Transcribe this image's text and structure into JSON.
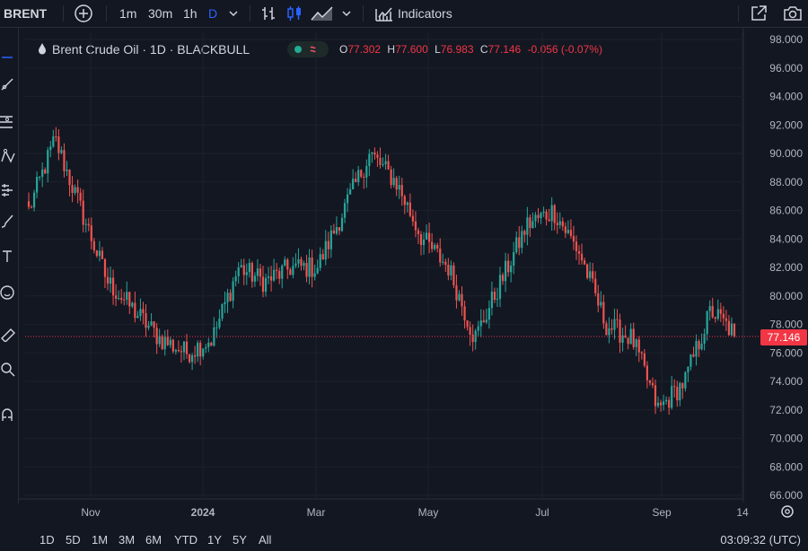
{
  "toolbar": {
    "symbol": "BRENT",
    "intervals": [
      "1m",
      "30m",
      "1h",
      "D"
    ],
    "active_interval": "D",
    "indicators_label": "Indicators"
  },
  "legend": {
    "title": "Brent Crude Oil · 1D · BLACKBULL",
    "open_label": "O",
    "open": "77.302",
    "high_label": "H",
    "high": "77.600",
    "low_label": "L",
    "low": "76.983",
    "close_label": "C",
    "close": "77.146",
    "change": "-0.056 (-0.07%)"
  },
  "price_scale": {
    "ticks": [
      "98.000",
      "96.000",
      "94.000",
      "92.000",
      "90.000",
      "88.000",
      "86.000",
      "84.000",
      "82.000",
      "80.000",
      "78.000",
      "76.000",
      "74.000",
      "72.000",
      "70.000",
      "68.000",
      "66.000"
    ],
    "last_price": "77.146"
  },
  "time_scale": {
    "labels": [
      "Nov",
      "2024",
      "Mar",
      "May",
      "Jul",
      "Sep",
      "14"
    ]
  },
  "bottombar": {
    "timeframes": [
      "1D",
      "5D",
      "1M",
      "3M",
      "6M",
      "YTD",
      "1Y",
      "5Y",
      "All"
    ],
    "clock": "03:09:32 (UTC)"
  },
  "colors": {
    "background": "#131722",
    "up": "#26a69a",
    "down": "#ef5350",
    "accent": "#2962ff",
    "last_price": "#f23645"
  },
  "chart_data": {
    "type": "candlestick",
    "ylim": [
      66,
      98
    ],
    "x": [
      "2023-10-05",
      "2023-10-19",
      "2023-11-02",
      "2023-11-16",
      "2023-11-30",
      "2023-12-14",
      "2023-12-28",
      "2024-01-11",
      "2024-01-25",
      "2024-02-08",
      "2024-02-22",
      "2024-03-07",
      "2024-03-21",
      "2024-04-04",
      "2024-04-18",
      "2024-05-02",
      "2024-05-16",
      "2024-05-30",
      "2024-06-13",
      "2024-06-27",
      "2024-07-11",
      "2024-07-25",
      "2024-08-08",
      "2024-08-22",
      "2024-09-05",
      "2024-09-19",
      "2024-10-03",
      "2024-10-10"
    ],
    "close": [
      86,
      91,
      86,
      81,
      79,
      77,
      76,
      77,
      82,
      81,
      82,
      82,
      86,
      90,
      88,
      84,
      82,
      77,
      81,
      85,
      86,
      83,
      78,
      77,
      72,
      74,
      79,
      77.146
    ]
  }
}
